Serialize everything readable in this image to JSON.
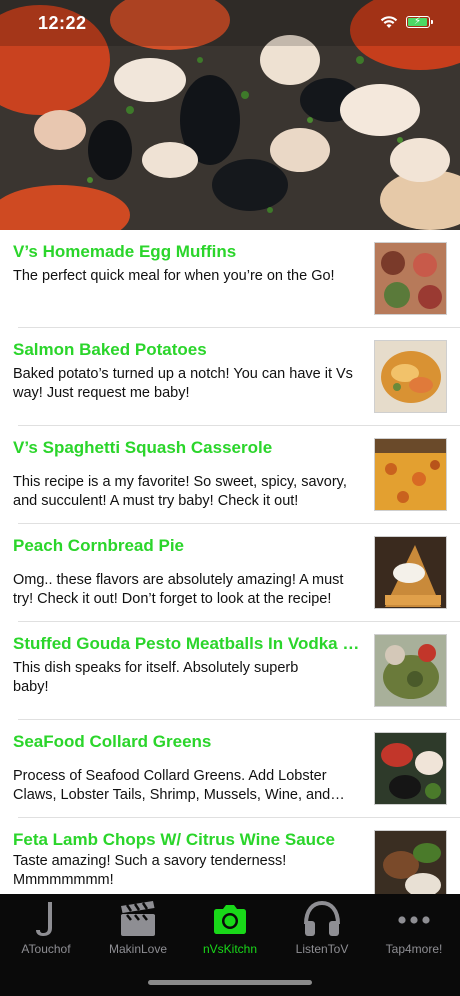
{
  "status_bar": {
    "time": "12:22"
  },
  "hero": {
    "image": "seafood-boil-photo"
  },
  "recipes": [
    {
      "title": "V’s Homemade Egg Muffins",
      "description": "The perfect quick meal for when you’re on the Go!",
      "thumb": "egg-muffins-thumb"
    },
    {
      "title": "Salmon Baked Potatoes",
      "description": "Baked potato’s turned up a notch!  You can have it Vs way!  Just request me baby!",
      "thumb": "salmon-potatoes-thumb"
    },
    {
      "title": "V’s Spaghetti Squash Casserole",
      "description": "This recipe is a my favorite! So sweet, spicy, savory, and succulent! A must try baby! Check it out!",
      "thumb": "squash-casserole-thumb"
    },
    {
      "title": "Peach Cornbread Pie",
      "description": "Omg.. these flavors are absolutely amazing! A must try! Check it out! Don’t forget to look at the recipe!",
      "thumb": "cornbread-pie-thumb"
    },
    {
      "title": "Stuffed Gouda Pesto Meatballs In Vodka Sauce",
      "description": "This dish speaks for itself. Absolutely superb baby!",
      "thumb": "meatballs-thumb"
    },
    {
      "title": "SeaFood Collard Greens",
      "description": "Process of Seafood Collard Greens.  Add Lobster Claws, Lobster Tails, Shrimp, Mussels, Wine, and more!",
      "thumb": "collard-greens-thumb"
    },
    {
      "title": "Feta Lamb Chops W/ Citrus Wine Sauce",
      "description": "Taste amazing! Such a savory tenderness! Mmmmmmmm!",
      "thumb": "lamb-chops-thumb"
    }
  ],
  "tabs": [
    {
      "label": "ATouchof",
      "icon": "letter-j-icon"
    },
    {
      "label": "MakinLove",
      "icon": "clapperboard-icon"
    },
    {
      "label": "nVsKitchn",
      "icon": "camera-icon",
      "active": true
    },
    {
      "label": "ListenToV",
      "icon": "headphones-icon"
    },
    {
      "label": "Tap4more!",
      "icon": "more-dots-icon"
    }
  ],
  "colors": {
    "accent": "#2bd52b",
    "tab_active": "#19d819",
    "tab_inactive": "#8e8e93",
    "tabbar_bg": "#0a0a0a"
  }
}
